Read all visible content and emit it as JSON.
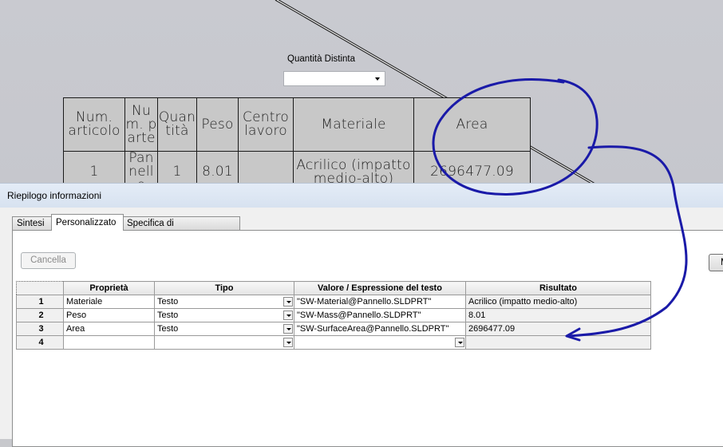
{
  "bom": {
    "headers": [
      "Num. articolo",
      "Num. parte",
      "Quantità",
      "Peso",
      "Centro lavoro",
      "Materiale",
      "Area"
    ],
    "row": [
      "1",
      "Pannello",
      "1",
      "8.01",
      "",
      "Acrilico (impatto medio-alto)",
      "2696477.09"
    ]
  },
  "dialog": {
    "title": "Riepilogo informazioni",
    "tabs": [
      "Sintesi",
      "Personalizzato",
      "Specifica di configurazione"
    ],
    "active_tab": "Personalizzato",
    "qty_label": "Quantità Distinta",
    "qty_value": "",
    "cancel_label": "Cancella",
    "right_button_label": "M",
    "grid": {
      "columns": [
        "Proprietà",
        "Tipo",
        "Valore / Espressione del testo",
        "Risultato"
      ],
      "rows": [
        {
          "num": "1",
          "prop": "Materiale",
          "tipo": "Testo",
          "valore": "\"SW-Material@Pannello.SLDPRT\"",
          "risultato": "Acrilico (impatto medio-alto)"
        },
        {
          "num": "2",
          "prop": "Peso",
          "tipo": "Testo",
          "valore": "\"SW-Mass@Pannello.SLDPRT\"",
          "risultato": "8.01"
        },
        {
          "num": "3",
          "prop": "Area",
          "tipo": "Testo",
          "valore": "\"SW-SurfaceArea@Pannello.SLDPRT\"",
          "risultato": "2696477.09"
        },
        {
          "num": "4",
          "prop": "",
          "tipo": "",
          "valore": "",
          "risultato": ""
        }
      ]
    }
  },
  "colors": {
    "annotation": "#1a1aa8",
    "title_bar": "#dbe5f2",
    "cad_background": "#c7c8cc"
  }
}
